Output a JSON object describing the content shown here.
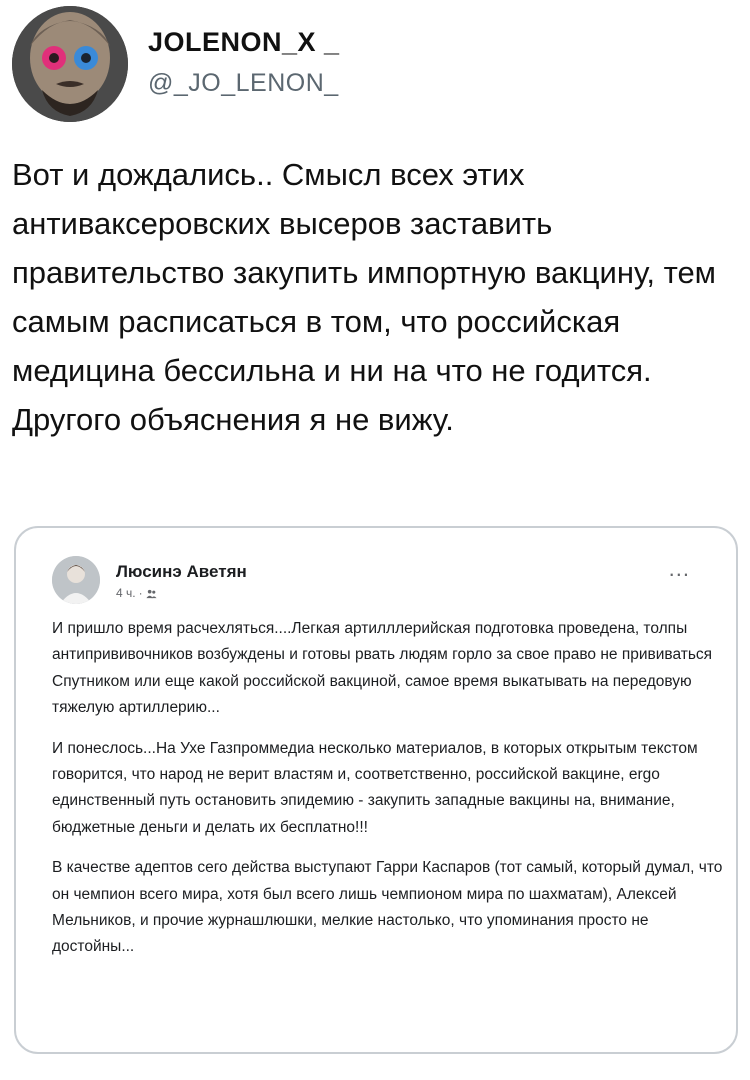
{
  "author": {
    "display_name": "JOLENON_X _",
    "handle": "@_JO_LENON_"
  },
  "tweet": {
    "text": "Вот и дождались.. Смысл всех этих антиваксеровских высеров заставить правительство закупить импортную вакцину, тем самым расписаться в том, что российская медицина бессильна и ни на что не годится. Другого объяснения я не вижу."
  },
  "embedded_post": {
    "author_name": "Люсинэ Аветян",
    "time": "4 ч.",
    "privacy_icon": "friends-icon",
    "more_label": "...",
    "paragraphs": [
      "И пришло время расчехляться....Легкая артилллерийская подготовка проведена, толпы антипрививочников возбуждены и готовы рвать людям горло за свое право не прививаться Спутником или еще какой российской вакциной, самое время выкатывать на передовую тяжелую артиллерию...",
      "И понеслось...На Ухе Газпроммедиа несколько материалов, в которых открытым текстом говорится, что народ не верит властям и, соответственно, российской вакцине, ergo единственный путь остановить эпидемию - закупить западные вакцины на, внимание, бюджетные деньги и делать их бесплатно!!!",
      "В качестве адептов сего действа выступают Гарри Каспаров (тот самый, который думал, что он чемпион всего мира, хотя был всего лишь чемпионом мира по шахматам), Алексей Мельников, и прочие журнашлюшки, мелкие настолько, что упоминания просто не достойны..."
    ]
  }
}
